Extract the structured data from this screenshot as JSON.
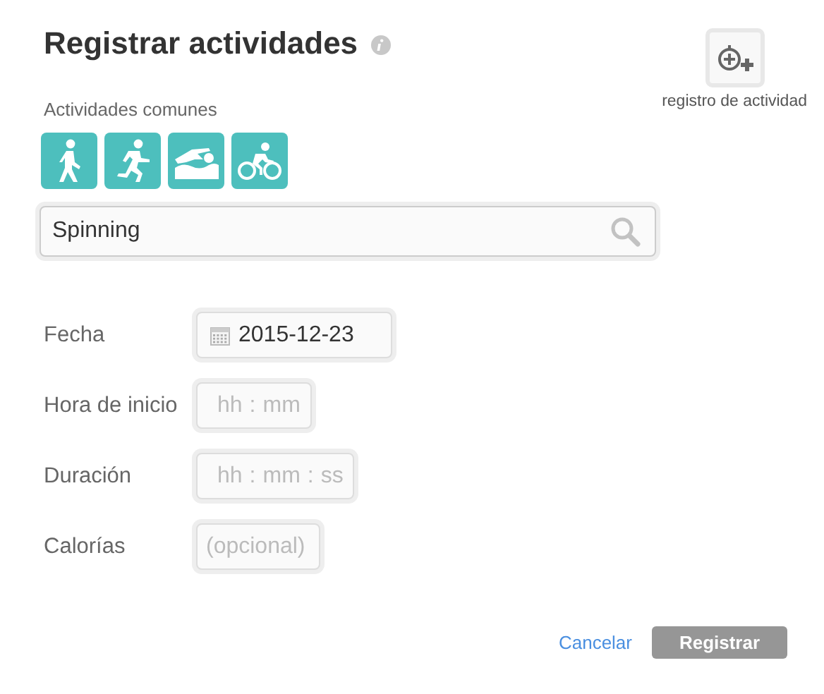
{
  "title": "Registrar actividades",
  "log_button": {
    "label": "registro de actividad"
  },
  "common": {
    "label": "Actividades comunes",
    "activities": [
      {
        "kind": "walk"
      },
      {
        "kind": "run"
      },
      {
        "kind": "swim"
      },
      {
        "kind": "bike"
      }
    ]
  },
  "search": {
    "value": "Spinning"
  },
  "fields": [
    {
      "label": "Fecha",
      "kind": "date",
      "value": "2015-12-23"
    },
    {
      "label": "Hora de inicio",
      "kind": "time",
      "segments": [
        {
          "kind": "input",
          "placeholder": "hh"
        },
        {
          "kind": "sep",
          "text": ":"
        },
        {
          "kind": "input",
          "placeholder": "mm"
        }
      ]
    },
    {
      "label": "Duración",
      "kind": "time",
      "segments": [
        {
          "kind": "input",
          "placeholder": "hh"
        },
        {
          "kind": "sep",
          "text": ":"
        },
        {
          "kind": "input",
          "placeholder": "mm"
        },
        {
          "kind": "sep",
          "text": ":"
        },
        {
          "kind": "input",
          "placeholder": "ss"
        }
      ]
    },
    {
      "label": "Calorías",
      "kind": "text",
      "placeholder": "(opcional)"
    }
  ],
  "actions": {
    "cancel": "Cancelar",
    "submit": "Registrar"
  }
}
